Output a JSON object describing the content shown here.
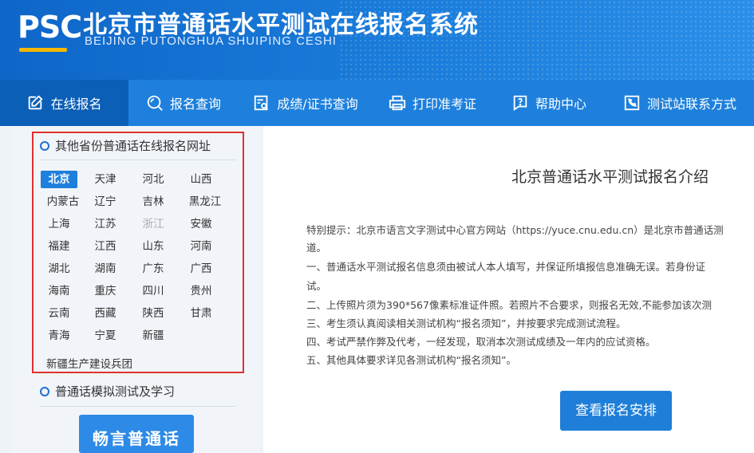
{
  "header": {
    "logo_text": "PSC",
    "title": "北京市普通话水平测试在线报名系统",
    "subtitle": "BEIJING PUTONGHUA SHUIPING CESHI"
  },
  "nav": {
    "items": [
      {
        "label": "在线报名",
        "icon": "edit-icon",
        "active": true
      },
      {
        "label": "报名查询",
        "icon": "search-icon"
      },
      {
        "label": "成绩/证书查询",
        "icon": "certificate-search-icon"
      },
      {
        "label": "打印准考证",
        "icon": "printer-icon"
      },
      {
        "label": "帮助中心",
        "icon": "help-icon"
      },
      {
        "label": "测试站联系方式",
        "icon": "phone-icon"
      }
    ]
  },
  "left": {
    "provinces_title": "其他省份普通话在线报名网址",
    "provinces": [
      [
        "北京",
        "天津",
        "河北",
        "山西"
      ],
      [
        "内蒙古",
        "辽宁",
        "吉林",
        "黑龙江"
      ],
      [
        "上海",
        "江苏",
        "浙江",
        "安徽"
      ],
      [
        "福建",
        "江西",
        "山东",
        "河南"
      ],
      [
        "湖北",
        "湖南",
        "广东",
        "广西"
      ],
      [
        "海南",
        "重庆",
        "四川",
        "贵州"
      ],
      [
        "云南",
        "西藏",
        "陕西",
        "甘肃"
      ],
      [
        "青海",
        "宁夏",
        "新疆"
      ]
    ],
    "active_province": "北京",
    "disabled_province": "浙江",
    "corps": "新疆生产建设兵团",
    "practice_title": "普通话模拟测试及学习",
    "practice_button": "畅言普通话"
  },
  "right": {
    "title": "北京普通话水平测试报名介绍",
    "notice_lines": [
      "特别提示：北京市语言文字测试中心官方网站（https://yuce.cnu.edu.cn）是北京市普通话测",
      "道。",
      "一、普通话水平测试报名信息须由被试人本人填写，并保证所填报信息准确无误。若身份证",
      "试。",
      "二、上传照片须为390*567像素标准证件照。若照片不合要求，则报名无效,不能参加该次测",
      "三、考生须认真阅读相关测试机构“报名须知”，并按要求完成测试流程。",
      "四、考试严禁作弊及代考，一经发现，取消本次测试成绩及一年内的应试资格。",
      "五、其他具体要求详见各测试机构“报名须知”。"
    ],
    "view_button": "查看报名安排"
  },
  "colors": {
    "header_blue": "#1b7ddb",
    "nav_blue": "#1e80dc",
    "nav_active": "#0b5fb7",
    "highlight_red": "#e03030",
    "logo_accent": "#f5b800"
  }
}
